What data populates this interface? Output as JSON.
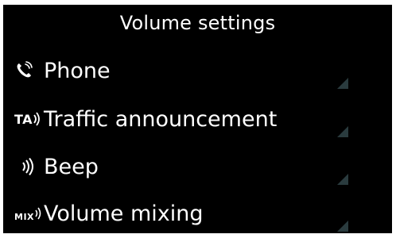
{
  "header": {
    "title": "Volume settings"
  },
  "items": [
    {
      "label": "Phone",
      "icon": "phone-icon"
    },
    {
      "label": "Traffic announcement",
      "icon": "traffic-announcement-icon",
      "icon_text": "TA"
    },
    {
      "label": "Beep",
      "icon": "beep-icon"
    },
    {
      "label": "Volume mixing",
      "icon": "volume-mixing-icon",
      "icon_text": "MIX"
    }
  ],
  "colors": {
    "background": "#000000",
    "text": "#ffffff",
    "corner_arrow": "#2a3b3e"
  }
}
